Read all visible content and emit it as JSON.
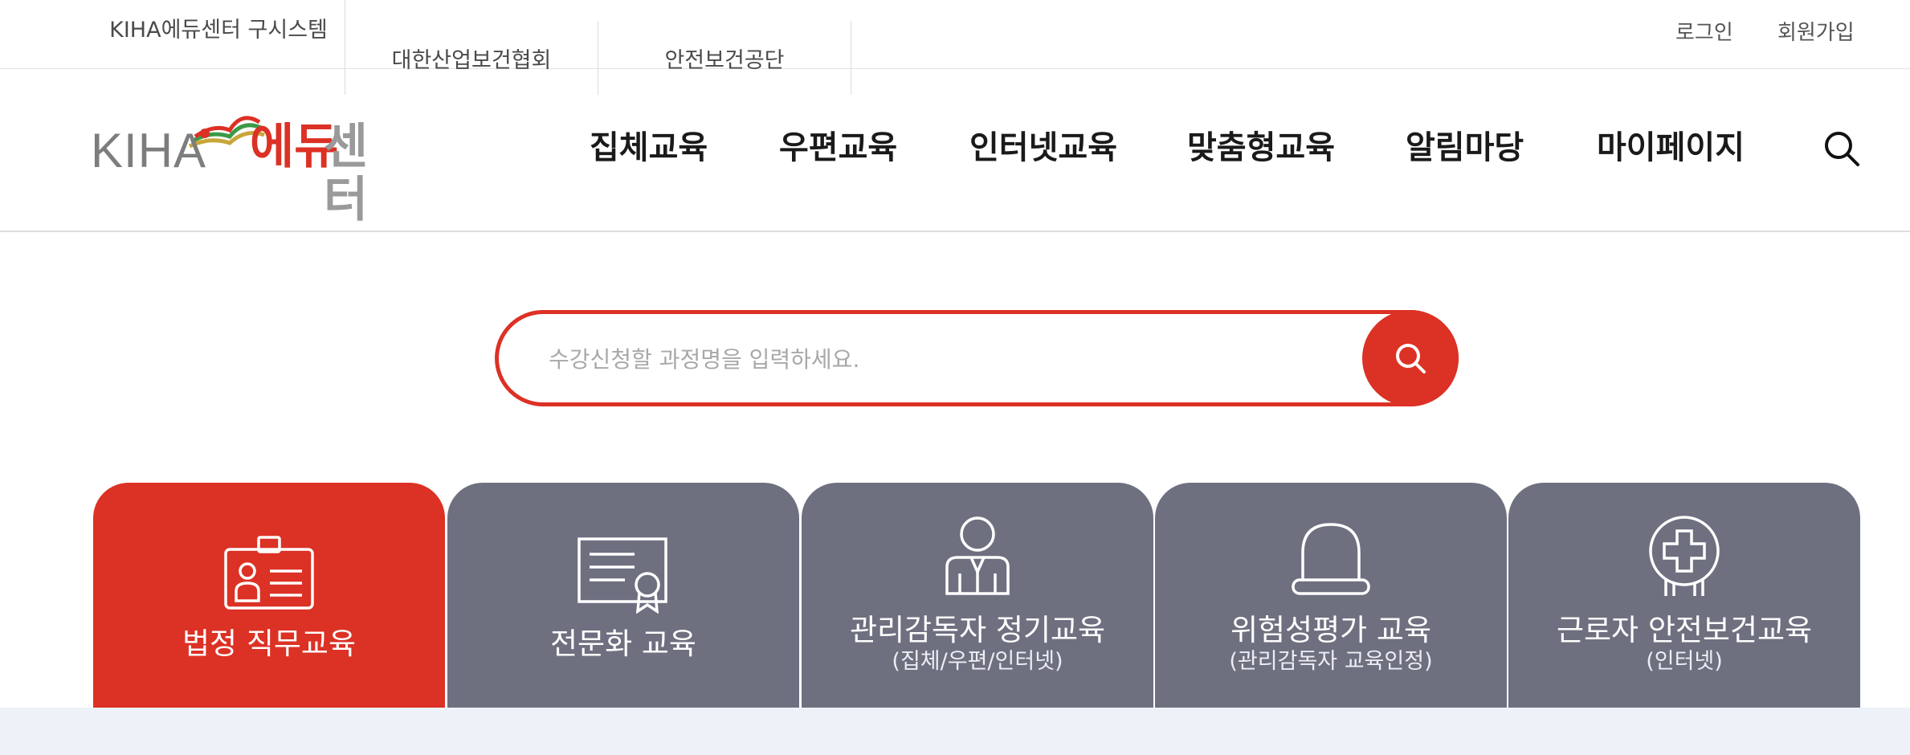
{
  "top_bar": {
    "family_sites": [
      {
        "label": "KIHA에듀센터 구시스템"
      },
      {
        "label": "대한산업보건협회"
      },
      {
        "label": "안전보건공단"
      }
    ],
    "login": "로그인",
    "join": "회원가입"
  },
  "header": {
    "logo": {
      "kiha": "KIHA",
      "edu_red": "에듀",
      "edu_gray": "센터"
    },
    "nav": [
      {
        "label": "집체교육"
      },
      {
        "label": "우편교육"
      },
      {
        "label": "인터넷교육"
      },
      {
        "label": "맞춤형교육"
      },
      {
        "label": "알림마당"
      },
      {
        "label": "마이페이지"
      }
    ],
    "search_icon": "search-icon"
  },
  "search": {
    "placeholder": "수강신청할 과정명을 입력하세요.",
    "value": ""
  },
  "categories": [
    {
      "title": "법정 직무교육",
      "subtitle": "",
      "icon": "id-badge-icon",
      "active": true
    },
    {
      "title": "전문화 교육",
      "subtitle": "",
      "icon": "certificate-icon",
      "active": false
    },
    {
      "title": "관리감독자 정기교육",
      "subtitle": "(집체/우편/인터넷)",
      "icon": "supervisor-icon",
      "active": false
    },
    {
      "title": "위험성평가 교육",
      "subtitle": "(관리감독자 교육인정)",
      "icon": "warning-light-icon",
      "active": false
    },
    {
      "title": "근로자 안전보건교육",
      "subtitle": "(인터넷)",
      "icon": "medical-cross-icon",
      "active": false
    }
  ],
  "colors": {
    "brand_red": "#dc3125",
    "card_gray": "#6e7080",
    "band": "#edf2f9"
  }
}
